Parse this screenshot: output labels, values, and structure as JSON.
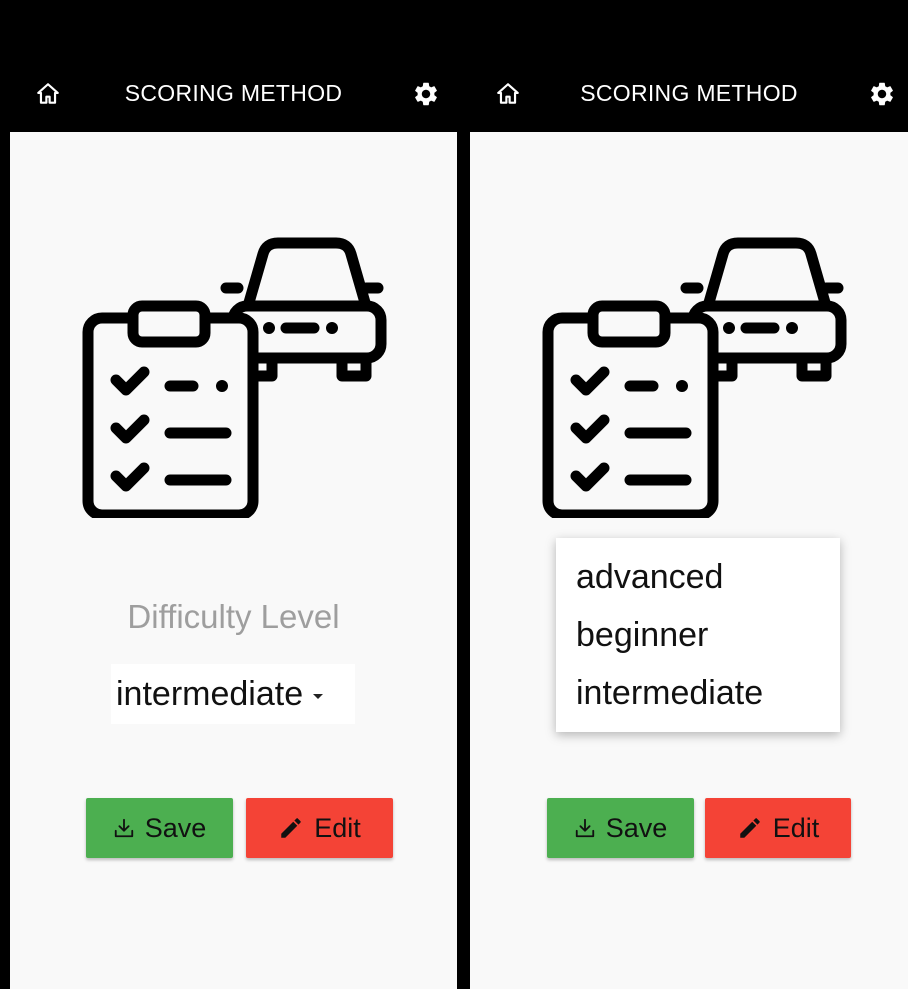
{
  "app": {
    "title": "SCORING METHOD"
  },
  "colors": {
    "save": "#4caf50",
    "edit": "#f44336",
    "topbar": "#000000",
    "label": "#9e9e9e"
  },
  "icons": {
    "home": "home-icon",
    "settings": "gear-icon",
    "illustration": "checklist-car-icon",
    "save": "download-icon",
    "edit": "pencil-icon"
  },
  "form": {
    "label": "Difficulty Level",
    "selected": "intermediate",
    "options": [
      "advanced",
      "beginner",
      "intermediate"
    ]
  },
  "buttons": {
    "save": "Save",
    "edit": "Edit"
  }
}
